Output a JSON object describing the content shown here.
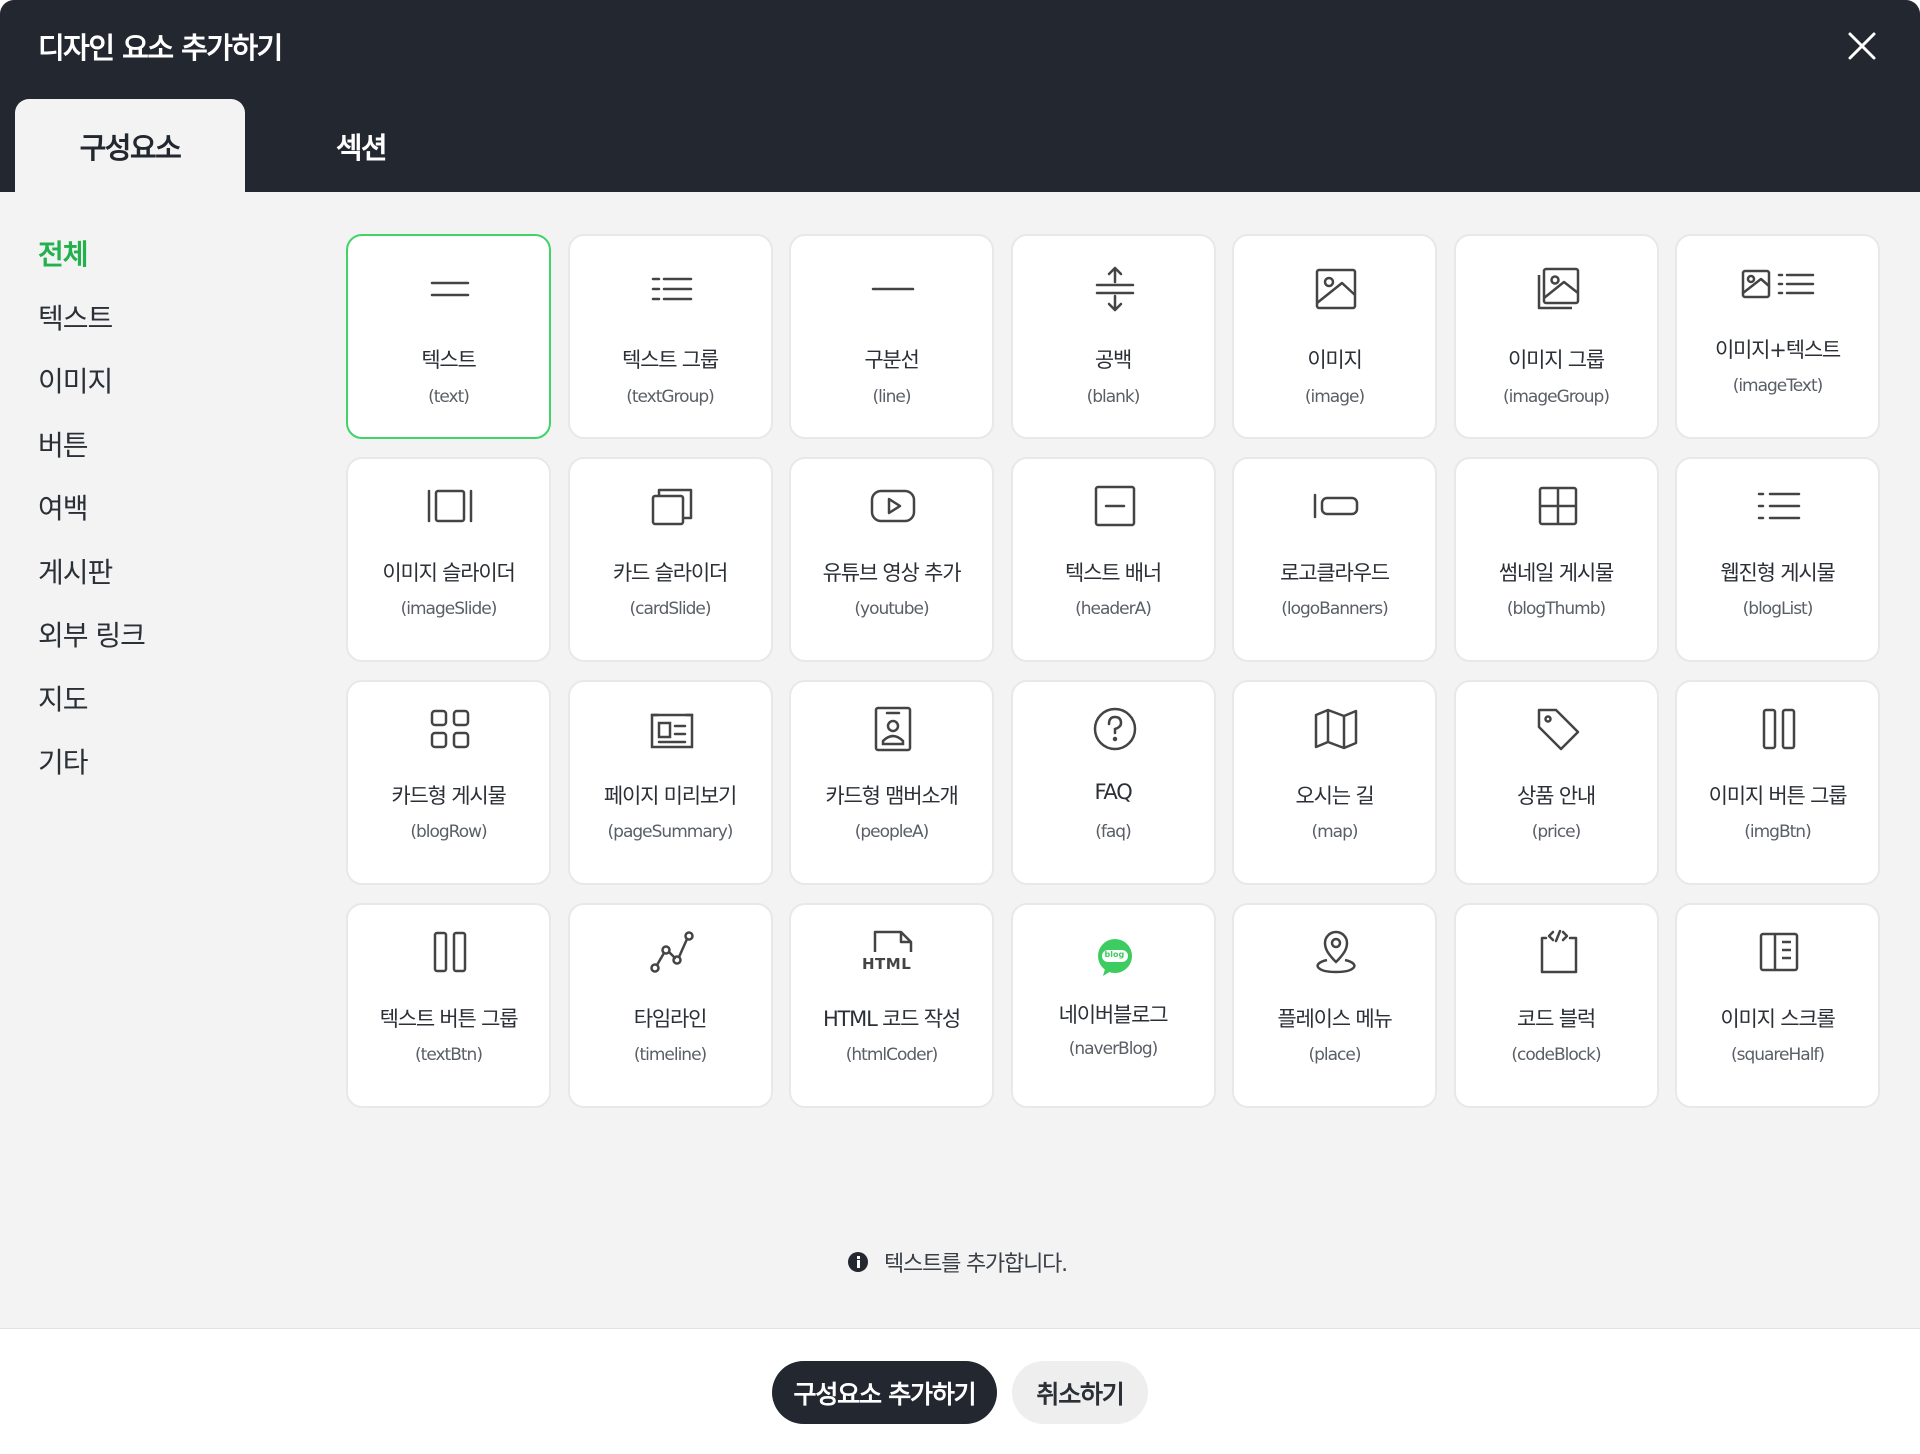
{
  "dialog": {
    "title": "디자인 요소 추가하기",
    "close_icon": "close-icon"
  },
  "tabs": [
    {
      "label": "구성요소",
      "active": true
    },
    {
      "label": "섹션",
      "active": false
    }
  ],
  "sidebar": {
    "items": [
      {
        "label": "전체",
        "active": true
      },
      {
        "label": "텍스트"
      },
      {
        "label": "이미지"
      },
      {
        "label": "버튼"
      },
      {
        "label": "여백"
      },
      {
        "label": "게시판"
      },
      {
        "label": "외부 링크"
      },
      {
        "label": "지도"
      },
      {
        "label": "기타"
      }
    ]
  },
  "components": [
    {
      "name": "텍스트",
      "code": "(text)",
      "icon": "text-icon"
    },
    {
      "name": "텍스트 그룹",
      "code": "(textGroup)",
      "icon": "text-group-icon"
    },
    {
      "name": "구분선",
      "code": "(line)",
      "icon": "line-icon"
    },
    {
      "name": "공백",
      "code": "(blank)",
      "icon": "blank-icon"
    },
    {
      "name": "이미지",
      "code": "(image)",
      "icon": "image-icon"
    },
    {
      "name": "이미지 그룹",
      "code": "(imageGroup)",
      "icon": "image-group-icon"
    },
    {
      "name": "이미지+텍스트",
      "code": "(imageText)",
      "icon": "image-text-icon"
    },
    {
      "name": "이미지 슬라이더",
      "code": "(imageSlide)",
      "icon": "image-slide-icon"
    },
    {
      "name": "카드 슬라이더",
      "code": "(cardSlide)",
      "icon": "card-slide-icon"
    },
    {
      "name": "유튜브 영상 추가",
      "code": "(youtube)",
      "icon": "youtube-icon"
    },
    {
      "name": "텍스트 배너",
      "code": "(headerA)",
      "icon": "text-banner-icon"
    },
    {
      "name": "로고클라우드",
      "code": "(logoBanners)",
      "icon": "logo-cloud-icon"
    },
    {
      "name": "썸네일 게시물",
      "code": "(blogThumb)",
      "icon": "thumbnail-grid-icon"
    },
    {
      "name": "웹진형 게시물",
      "code": "(blogList)",
      "icon": "list-icon"
    },
    {
      "name": "카드형 게시물",
      "code": "(blogRow)",
      "icon": "card-grid-icon"
    },
    {
      "name": "페이지 미리보기",
      "code": "(pageSummary)",
      "icon": "page-preview-icon"
    },
    {
      "name": "카드형 맴버소개",
      "code": "(peopleA)",
      "icon": "member-card-icon"
    },
    {
      "name": "FAQ",
      "code": "(faq)",
      "icon": "question-icon"
    },
    {
      "name": "오시는 길",
      "code": "(map)",
      "icon": "map-icon"
    },
    {
      "name": "상품 안내",
      "code": "(price)",
      "icon": "tag-icon"
    },
    {
      "name": "이미지 버튼 그룹",
      "code": "(imgBtn)",
      "icon": "columns-icon"
    },
    {
      "name": "텍스트 버튼 그룹",
      "code": "(textBtn)",
      "icon": "columns-icon"
    },
    {
      "name": "타임라인",
      "code": "(timeline)",
      "icon": "timeline-icon"
    },
    {
      "name": "HTML 코드 작성",
      "code": "(htmlCoder)",
      "icon": "html-icon",
      "icon_text": "HTML"
    },
    {
      "name": "네이버블로그",
      "code": "(naverBlog)",
      "icon": "naver-blog-icon",
      "icon_text": "blog"
    },
    {
      "name": "플레이스 메뉴",
      "code": "(place)",
      "icon": "location-pin-icon"
    },
    {
      "name": "코드 블럭",
      "code": "(codeBlock)",
      "icon": "code-block-icon"
    },
    {
      "name": "이미지 스크롤",
      "code": "(squareHalf)",
      "icon": "square-half-icon"
    }
  ],
  "selected_index": 0,
  "info_text": "텍스트를 추가합니다.",
  "footer": {
    "primary_label": "구성요소 추가하기",
    "secondary_label": "취소하기"
  },
  "colors": {
    "header_bg": "#222730",
    "accent_green": "#41d26a",
    "active_text_green": "#22b14c",
    "naver_green": "#3ccc5f"
  }
}
